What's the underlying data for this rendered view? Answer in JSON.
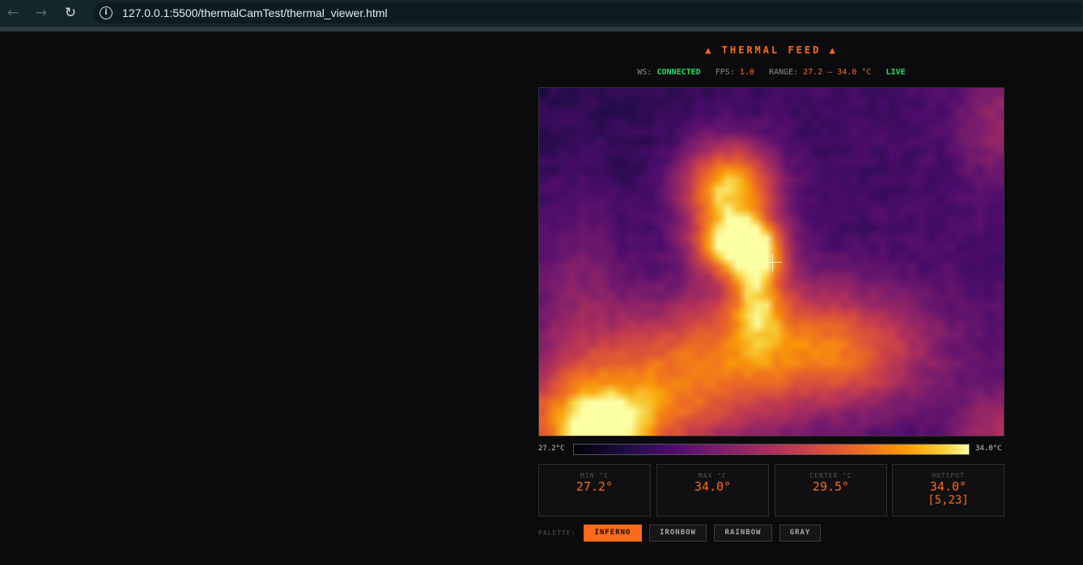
{
  "browser": {
    "url": "127.0.0.1:5500/thermalCamTest/thermal_viewer.html",
    "icons": {
      "back": "arrow-left-icon",
      "forward": "arrow-right-icon",
      "reload": "reload-icon",
      "info": "info-icon"
    }
  },
  "header": {
    "title": "▲ THERMAL FEED ▲"
  },
  "status": {
    "ws_label": "WS:",
    "ws_value": "CONNECTED",
    "fps_label": "FPS:",
    "fps_value": "1.0",
    "range_label": "RANGE:",
    "range_value": "27.2 – 34.0 °C",
    "live": "LIVE"
  },
  "scale": {
    "min_label": "27.2°C",
    "max_label": "34.0°C"
  },
  "stats": [
    {
      "label": "MIN °C",
      "value": "27.2°"
    },
    {
      "label": "MAX °C",
      "value": "34.0°"
    },
    {
      "label": "CENTER °C",
      "value": "29.5°"
    },
    {
      "label": "HOTSPOT",
      "value": "34.0°",
      "sub": "[5,23]"
    }
  ],
  "palette": {
    "label": "PALETTE:",
    "options": [
      "INFERNO",
      "IRONBOW",
      "RAINBOW",
      "GRAY"
    ],
    "selected": "INFERNO"
  },
  "colors": {
    "accent": "#ff6a1a",
    "ok": "#22dd66",
    "background": "#0b0b0e"
  }
}
